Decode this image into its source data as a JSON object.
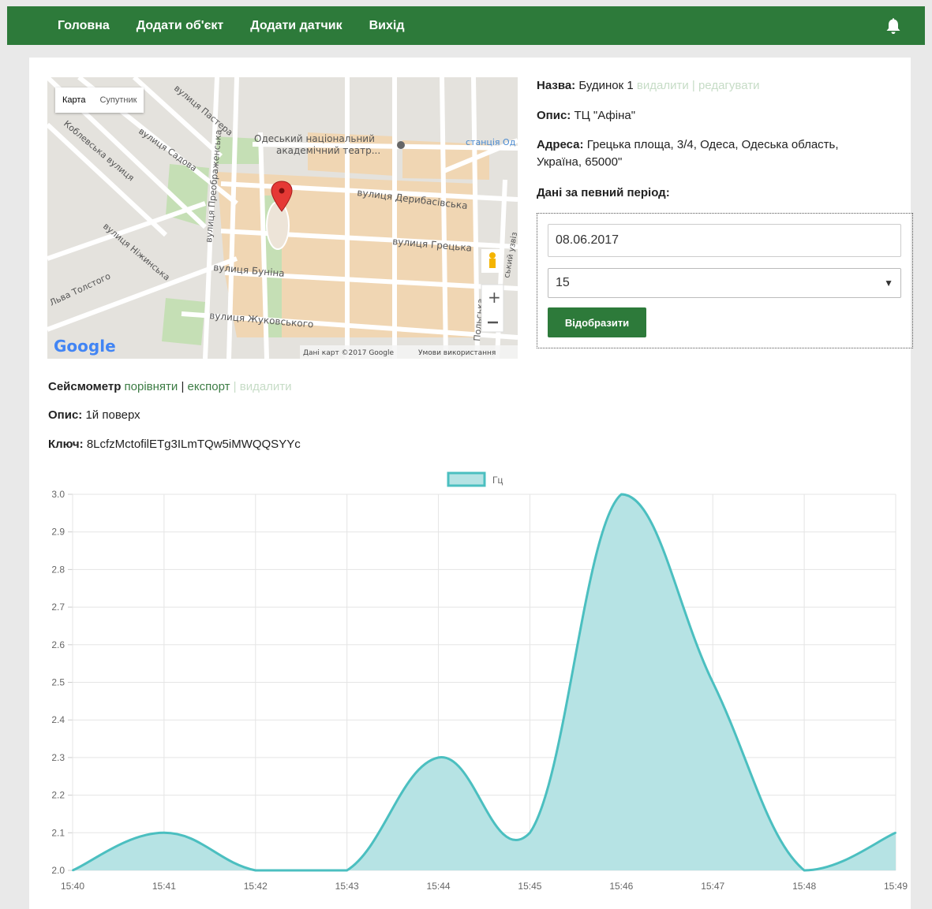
{
  "nav": {
    "items": [
      "Головна",
      "Додати об'єкт",
      "Додати датчик",
      "Вихід"
    ],
    "bell_icon": "bell-icon"
  },
  "map": {
    "type_map": "Карта",
    "type_satellite": "Супутник",
    "labels": {
      "theatre_1": "Одеський національний",
      "theatre_2": "академічний театр...",
      "station": "станція Од",
      "deribasivska": "вулиця Дерибасівська",
      "hretska": "вулиця Грецька",
      "bunina": "вулиця Буніна",
      "zhukovskoho": "вулиця Жуковського",
      "sadova": "вулиця Садова",
      "pastera": "вулиця Пастера",
      "koblevska": "Коблевська вулиця",
      "nizhynska": "вулиця Ніжинська",
      "lva_tolstoho": "Льва Толстого",
      "preobrazhenska": "вулиця Преображенська",
      "polska": "Польська",
      "uzviz": "ський узвіз"
    },
    "google": "Google",
    "attribution": "Дані карт ©2017 Google",
    "terms": "Умови використання"
  },
  "object": {
    "name_label": "Назва:",
    "name_value": "Будинок 1",
    "delete": "видалити",
    "separator": "|",
    "edit": "редагувати",
    "desc_label": "Опис:",
    "desc_value": "ТЦ \"Афіна\"",
    "address_label": "Адреса:",
    "address_value_1": "Грецька площа, 3/4, Одеса, Одеська область,",
    "address_value_2": "Україна, 65000\"",
    "period_title": "Дані за певний період:",
    "date_value": "08.06.2017",
    "select_value": "15",
    "show_button": "Відобразити"
  },
  "sensor": {
    "name": "Сейсмометр",
    "compare": "порівняти",
    "export": "експорт",
    "delete": "видалити",
    "sep": "|",
    "desc_label": "Опис:",
    "desc_value": "1й поверх",
    "key_label": "Ключ:",
    "key_value": "8LcfzMctofilETg3ILmTQw5iMWQQSYYc"
  },
  "chart_data": {
    "type": "area",
    "legend": "Гц",
    "categories": [
      "15:40",
      "15:41",
      "15:42",
      "15:43",
      "15:44",
      "15:45",
      "15:46",
      "15:47",
      "15:48",
      "15:49"
    ],
    "values": [
      2.0,
      2.1,
      2.0,
      2.0,
      2.3,
      2.1,
      3.0,
      2.5,
      2.0,
      2.1
    ],
    "yticks": [
      "3.0",
      "2.9",
      "2.8",
      "2.7",
      "2.6",
      "2.5",
      "2.4",
      "2.3",
      "2.2",
      "2.1",
      "2.0"
    ],
    "ylim": [
      2.0,
      3.0
    ],
    "line_color": "#4bbfc0",
    "fill_color": "#b6e3e4",
    "grid": true,
    "legend_position": "top-center"
  }
}
